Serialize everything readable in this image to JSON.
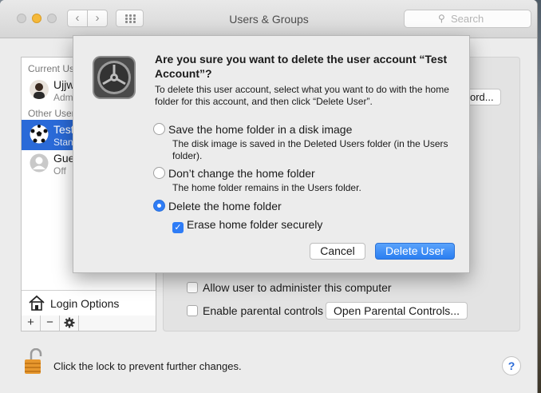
{
  "window": {
    "title": "Users & Groups",
    "search_placeholder": "Search"
  },
  "sidebar": {
    "current_users_label": "Current Us",
    "current_user": {
      "name": "Ujjw",
      "role": "Admi"
    },
    "other_users_label": "Other User",
    "users": [
      {
        "name": "Test",
        "status": "Stan"
      },
      {
        "name": "Gue",
        "status": "Off"
      }
    ],
    "login_options_label": "Login Options",
    "tools": {
      "add": "+",
      "remove": "−",
      "settings": "gear-icon"
    }
  },
  "panel": {
    "password_button_label": "ord...",
    "admin_checkbox_label": "Allow user to administer this computer",
    "parental_checkbox_label": "Enable parental controls",
    "parental_button_label": "Open Parental Controls..."
  },
  "footer": {
    "lock_text": "Click the lock to prevent further changes.",
    "help_label": "?"
  },
  "dialog": {
    "icon": "system-preferences-gear-icon",
    "title": "Are you sure you want to delete the user account “Test Account”?",
    "description": "To delete this user account, select what you want to do with the home folder for this account, and then click “Delete User”.",
    "options": [
      {
        "label": "Save the home folder in a disk image",
        "note": "The disk image is saved in the Deleted Users folder (in the Users folder).",
        "selected": false
      },
      {
        "label": "Don’t change the home folder",
        "note": "The home folder remains in the Users folder.",
        "selected": false
      },
      {
        "label": "Delete the home folder",
        "note": "",
        "selected": true
      }
    ],
    "erase_label": "Erase home folder securely",
    "erase_checked": true,
    "cancel_label": "Cancel",
    "delete_label": "Delete User"
  },
  "colors": {
    "accent": "#2e7cf6",
    "selection": "#2a6ad8",
    "minimize": "#f5b93a"
  }
}
